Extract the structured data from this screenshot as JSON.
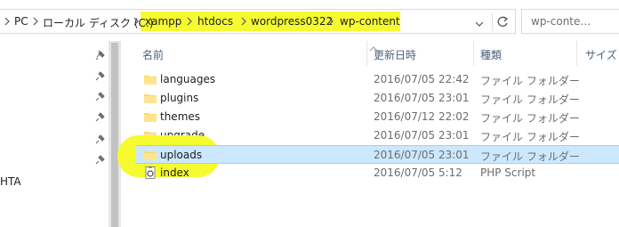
{
  "address_bar": {
    "crumbs": [
      "PC",
      "ローカル ディスク (C:)",
      "xampp",
      "htdocs",
      "wordpress0322",
      "wp-content"
    ]
  },
  "search": {
    "placeholder": "wp-conte…"
  },
  "nav": {
    "partial_item": "HTA"
  },
  "columns": {
    "name": "名前",
    "date": "更新日時",
    "type": "種類",
    "size": "サイズ"
  },
  "files": [
    {
      "name": "languages",
      "date": "2016/07/05 22:42",
      "type": "ファイル フォルダー",
      "icon": "folder-icon"
    },
    {
      "name": "plugins",
      "date": "2016/07/05 23:01",
      "type": "ファイル フォルダー",
      "icon": "folder-icon"
    },
    {
      "name": "themes",
      "date": "2016/07/12 22:02",
      "type": "ファイル フォルダー",
      "icon": "folder-icon"
    },
    {
      "name": "upgrade",
      "date": "2016/07/05 23:01",
      "type": "ファイル フォルダー",
      "icon": "folder-icon"
    },
    {
      "name": "uploads",
      "date": "2016/07/05 23:01",
      "type": "ファイル フォルダー",
      "icon": "folder-icon",
      "selected": true
    },
    {
      "name": "index",
      "date": "2016/07/05 5:12",
      "type": "PHP Script",
      "icon": "php-file-icon"
    }
  ],
  "colors": {
    "highlight": "#f5fb30",
    "selection": "#cce8ff",
    "folder": "#ffd75e"
  }
}
